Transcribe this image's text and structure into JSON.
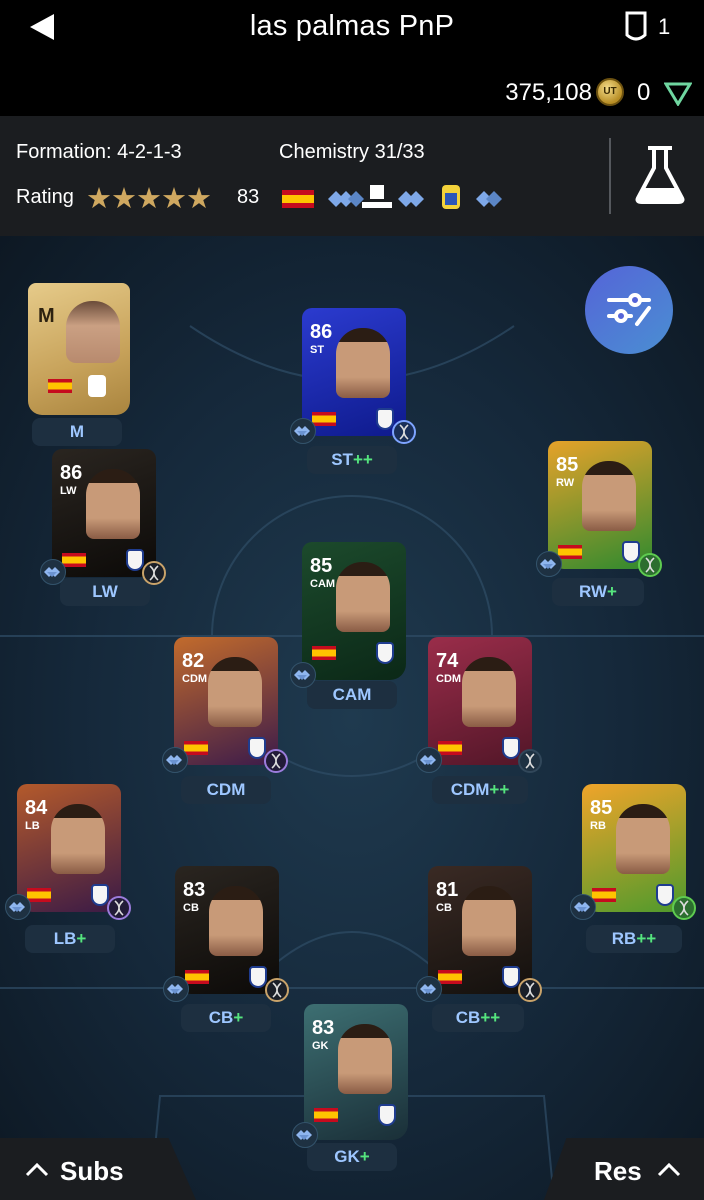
{
  "header": {
    "title": "las palmas PnP",
    "back_icon": "back-arrow-icon",
    "shield_count": "1",
    "coins": "375,108",
    "coin_label": "UT",
    "points": "0"
  },
  "info": {
    "formation": "Formation: 4-2-1-3",
    "chemistry": "Chemistry 31/33",
    "rating_label": "Rating",
    "stars": "★★★★★",
    "rating_value": "83"
  },
  "manager": {
    "label": "M",
    "card_letter": "M"
  },
  "players": [
    {
      "id": "st",
      "rating": "86",
      "pos": "ST",
      "slot": "ST",
      "plus": "++",
      "colors": [
        "#2b3bcf",
        "#0e1a8c"
      ],
      "dna": "blue"
    },
    {
      "id": "lw",
      "rating": "86",
      "pos": "LW",
      "slot": "LW",
      "plus": "",
      "colors": [
        "#2a2520",
        "#0c0a08"
      ],
      "dna": "gold"
    },
    {
      "id": "rw",
      "rating": "85",
      "pos": "RW",
      "slot": "RW",
      "plus": "+",
      "colors": [
        "#e6a22a",
        "#2f8a2f"
      ],
      "dna": "green"
    },
    {
      "id": "cam",
      "rating": "85",
      "pos": "CAM",
      "slot": "CAM",
      "plus": "",
      "colors": [
        "#1c4a2c",
        "#0b2817"
      ],
      "dna": "none"
    },
    {
      "id": "cdm1",
      "rating": "82",
      "pos": "CDM",
      "slot": "CDM",
      "plus": "",
      "colors": [
        "#c26b2c",
        "#3c1b4a"
      ],
      "dna": "purple"
    },
    {
      "id": "cdm2",
      "rating": "74",
      "pos": "CDM",
      "slot": "CDM",
      "plus": "++",
      "colors": [
        "#9a2d4a",
        "#521628"
      ],
      "dna": "grey"
    },
    {
      "id": "lb",
      "rating": "84",
      "pos": "LB",
      "slot": "LB",
      "plus": "+",
      "colors": [
        "#b45a2b",
        "#3a1a46"
      ],
      "dna": "purple"
    },
    {
      "id": "rb",
      "rating": "85",
      "pos": "RB",
      "slot": "RB",
      "plus": "++",
      "colors": [
        "#f0a42a",
        "#4e9a2c"
      ],
      "dna": "green"
    },
    {
      "id": "cb1",
      "rating": "83",
      "pos": "CB",
      "slot": "CB",
      "plus": "+",
      "colors": [
        "#2a2520",
        "#0c0a08"
      ],
      "dna": "gold"
    },
    {
      "id": "cb2",
      "rating": "81",
      "pos": "CB",
      "slot": "CB",
      "plus": "++",
      "colors": [
        "#3a2a24",
        "#13100d"
      ],
      "dna": "gold"
    },
    {
      "id": "gk",
      "rating": "83",
      "pos": "GK",
      "slot": "GK",
      "plus": "+",
      "colors": [
        "#3d6f72",
        "#1a2f38"
      ],
      "dna": "none"
    }
  ],
  "bottom": {
    "subs_label": "Subs",
    "res_label": "Res"
  },
  "colors": {
    "accent_blue": "#9ec7ff",
    "plus_green": "#55e57e",
    "star_gold": "#cfa860"
  }
}
